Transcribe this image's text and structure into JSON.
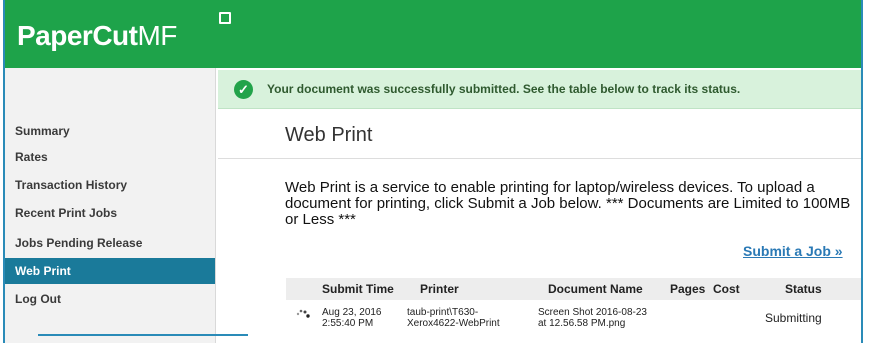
{
  "app": {
    "logo_main": "PaperCut",
    "logo_suffix": "MF"
  },
  "sidebar": {
    "items": [
      {
        "label": "Summary",
        "active": false
      },
      {
        "label": "Rates",
        "active": false
      },
      {
        "label": "Transaction History",
        "active": false
      },
      {
        "label": "Recent Print Jobs",
        "active": false
      },
      {
        "label": "Jobs Pending Release",
        "active": false
      },
      {
        "label": "Web Print",
        "active": true
      },
      {
        "label": "Log Out",
        "active": false
      }
    ]
  },
  "alert": {
    "icon": "check-circle-icon",
    "text": "Your document was successfully submitted. See the table below to track its status."
  },
  "main": {
    "title": "Web Print",
    "description": "Web Print is a service to enable printing for laptop/wireless devices. To upload a document for printing, click Submit a Job below. *** Documents are Limited to 100MB or Less ***",
    "submit_link": "Submit a Job »"
  },
  "table": {
    "headers": [
      "Submit Time",
      "Printer",
      "Document Name",
      "Pages",
      "Cost",
      "Status"
    ],
    "rows": [
      {
        "submit_time_line1": "Aug 23, 2016",
        "submit_time_line2": "2:55:40 PM",
        "printer_line1": "taub-print\\T630-",
        "printer_line2": "Xerox4622-WebPrint",
        "document_line1": "Screen Shot 2016-08-23",
        "document_line2": "at 12.56.58 PM.png",
        "pages": "",
        "cost": "",
        "status": "Submitting"
      }
    ]
  },
  "colors": {
    "brand_green": "#1ea34a",
    "active_nav": "#1a7a9a",
    "alert_bg": "#d8f2dc",
    "link": "#2a79b5"
  }
}
